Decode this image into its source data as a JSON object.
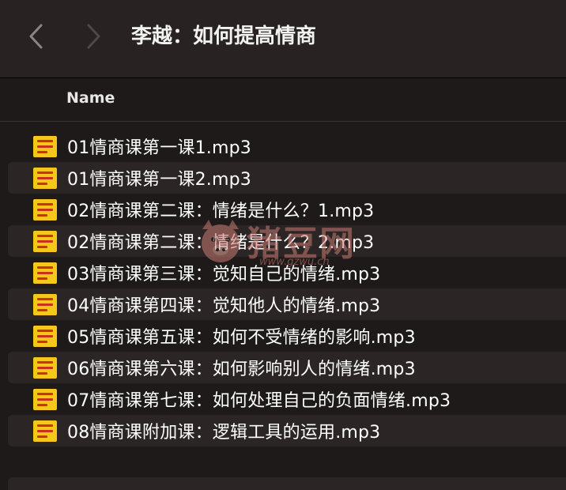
{
  "toolbar": {
    "title": "李越：如何提高情商",
    "back_icon": "chevron-left-icon",
    "forward_icon": "chevron-right-icon"
  },
  "columns": {
    "name": "Name"
  },
  "files": [
    {
      "name": "01情商课第一课1.mp3",
      "icon": "audio-file-icon"
    },
    {
      "name": "01情商课第一课2.mp3",
      "icon": "audio-file-icon"
    },
    {
      "name": "02情商课第二课：情绪是什么？1.mp3",
      "icon": "audio-file-icon"
    },
    {
      "name": "02情商课第二课：情绪是什么？2.mp3",
      "icon": "audio-file-icon"
    },
    {
      "name": "03情商课第三课：觉知自己的情绪.mp3",
      "icon": "audio-file-icon"
    },
    {
      "name": "04情商课第四课：觉知他人的情绪.mp3",
      "icon": "audio-file-icon"
    },
    {
      "name": "05情商课第五课：如何不受情绪的影响.mp3",
      "icon": "audio-file-icon"
    },
    {
      "name": "06情商课第六课：如何影响别人的情绪.mp3",
      "icon": "audio-file-icon"
    },
    {
      "name": "07情商课第七课：如何处理自己的负面情绪.mp3",
      "icon": "audio-file-icon"
    },
    {
      "name": "08情商课附加课：逻辑工具的运用.mp3",
      "icon": "audio-file-icon"
    }
  ],
  "watermark": {
    "text": "猪豆网",
    "url": "www.gzwu.cn",
    "icon": "pig-logo-icon"
  },
  "colors": {
    "background": "#1e1a1a",
    "toolbar": "#282322",
    "alt_row": "#2b2625",
    "file_icon": "#f4c71a",
    "file_icon_lines": "#c8321b"
  }
}
